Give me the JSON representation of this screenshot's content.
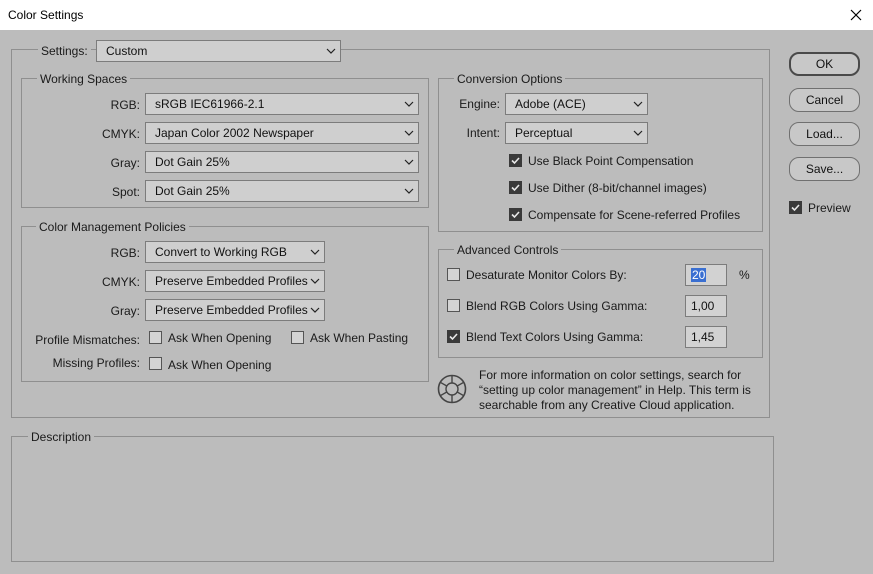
{
  "window": {
    "title": "Color Settings"
  },
  "settings": {
    "label": "Settings:",
    "value": "Custom"
  },
  "working_spaces": {
    "title": "Working Spaces",
    "rows": [
      {
        "label": "RGB:",
        "value": "sRGB IEC61966-2.1"
      },
      {
        "label": "CMYK:",
        "value": "Japan Color 2002 Newspaper"
      },
      {
        "label": "Gray:",
        "value": "Dot Gain 25%"
      },
      {
        "label": "Spot:",
        "value": "Dot Gain 25%"
      }
    ]
  },
  "policies": {
    "title": "Color Management Policies",
    "rows": [
      {
        "label": "RGB:",
        "value": "Convert to Working RGB"
      },
      {
        "label": "CMYK:",
        "value": "Preserve Embedded Profiles"
      },
      {
        "label": "Gray:",
        "value": "Preserve Embedded Profiles"
      }
    ],
    "mismatch_label": "Profile Mismatches:",
    "ask_opening": {
      "label": "Ask When Opening",
      "checked": false
    },
    "ask_pasting": {
      "label": "Ask When Pasting",
      "checked": false
    },
    "missing_label": "Missing Profiles:",
    "missing_ask_opening": {
      "label": "Ask When Opening",
      "checked": false
    }
  },
  "conversion": {
    "title": "Conversion Options",
    "engine_label": "Engine:",
    "engine_value": "Adobe (ACE)",
    "intent_label": "Intent:",
    "intent_value": "Perceptual",
    "black_point": {
      "label": "Use Black Point Compensation",
      "checked": true
    },
    "dither": {
      "label": "Use Dither (8-bit/channel images)",
      "checked": true
    },
    "scene": {
      "label": "Compensate for Scene-referred Profiles",
      "checked": true
    }
  },
  "advanced": {
    "title": "Advanced Controls",
    "desaturate": {
      "label": "Desaturate Monitor Colors By:",
      "checked": false,
      "value": "20",
      "unit": "%"
    },
    "blend_rgb": {
      "label": "Blend RGB Colors Using Gamma:",
      "checked": false,
      "value": "1,00"
    },
    "blend_text": {
      "label": "Blend Text Colors Using Gamma:",
      "checked": true,
      "value": "1,45"
    }
  },
  "info": {
    "icon": "color-wheel-icon",
    "line1": "For more information on color settings, search for",
    "line2": "“setting up color management” in Help. This term is",
    "line3": "searchable from any Creative Cloud application."
  },
  "description": {
    "title": "Description"
  },
  "buttons": {
    "ok": "OK",
    "cancel": "Cancel",
    "load": "Load...",
    "save": "Save..."
  },
  "preview": {
    "label": "Preview",
    "checked": true
  },
  "colors": {
    "background": "#bcbcbc",
    "titlebar": "#ffffff",
    "selection": "#3a6fd1"
  }
}
